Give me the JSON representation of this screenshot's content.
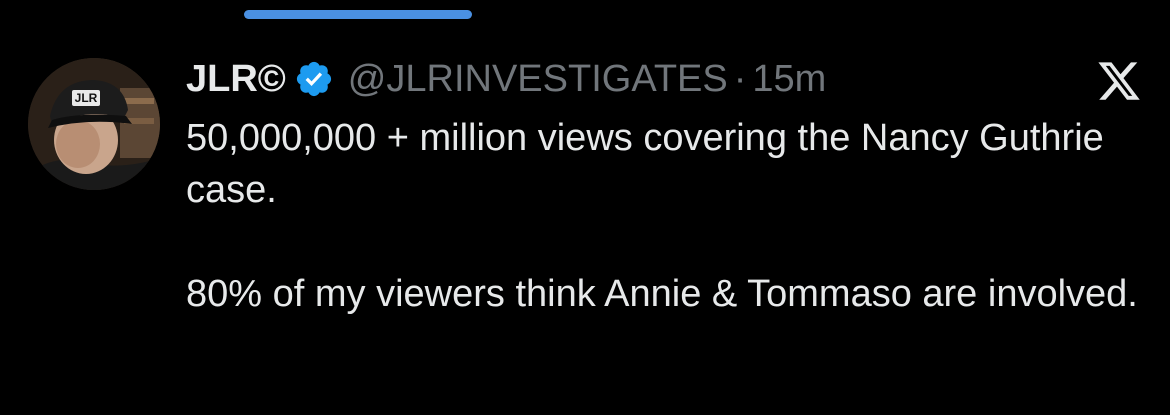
{
  "tweet": {
    "author": {
      "display_name": "JLR©",
      "handle": "@JLRINVESTIGATES",
      "verified": true,
      "avatar_icon": "person-in-cap-avatar",
      "avatar_cap_text": "JLR"
    },
    "separator": "·",
    "time": "15m",
    "text_paragraphs": [
      "50,000,000 + million views covering the Nancy Guthrie case.",
      "80% of my viewers think Annie & Tommaso are involved."
    ]
  },
  "icons": {
    "verified": "verified-badge-icon",
    "brand": "x-logo-icon"
  },
  "colors": {
    "background": "#000000",
    "primary_text": "#e7e9ea",
    "secondary_text": "#71767b",
    "verified_blue": "#1d9bf0",
    "top_indicator": "#4a90e2"
  }
}
